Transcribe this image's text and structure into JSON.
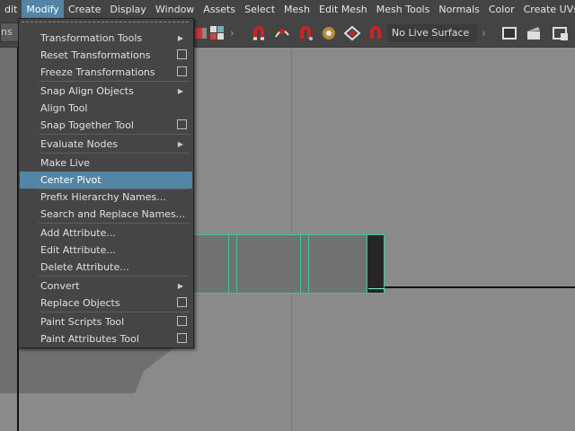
{
  "menubar": {
    "items": [
      "dit",
      "Modify",
      "Create",
      "Display",
      "Window",
      "Assets",
      "Select",
      "Mesh",
      "Edit Mesh",
      "Mesh Tools",
      "Normals",
      "Color",
      "Create UVs"
    ],
    "active": "Modify"
  },
  "toolbar": {
    "left_label": "ns",
    "live_surface": "No Live Surface"
  },
  "menu": {
    "items": [
      {
        "label": "Transformation Tools",
        "submenu": true
      },
      {
        "label": "Reset Transformations",
        "option_box": true
      },
      {
        "label": "Freeze Transformations",
        "option_box": true
      },
      {
        "label": "Snap Align Objects",
        "submenu": true
      },
      {
        "label": "Align Tool"
      },
      {
        "label": "Snap Together Tool",
        "option_box": true
      },
      {
        "label": "Evaluate Nodes",
        "submenu": true
      },
      {
        "label": "Make Live"
      },
      {
        "label": "Center Pivot",
        "highlighted": true
      },
      {
        "label": "Prefix Hierarchy Names..."
      },
      {
        "label": "Search and Replace Names..."
      },
      {
        "label": "Add Attribute..."
      },
      {
        "label": "Edit Attribute..."
      },
      {
        "label": "Delete Attribute..."
      },
      {
        "label": "Convert",
        "submenu": true
      },
      {
        "label": "Replace Objects",
        "option_box": true
      },
      {
        "label": "Paint Scripts Tool",
        "option_box": true
      },
      {
        "label": "Paint Attributes Tool",
        "option_box": true
      }
    ]
  },
  "colors": {
    "highlight": "#5285a6",
    "selection_wire": "#3ec79b"
  }
}
